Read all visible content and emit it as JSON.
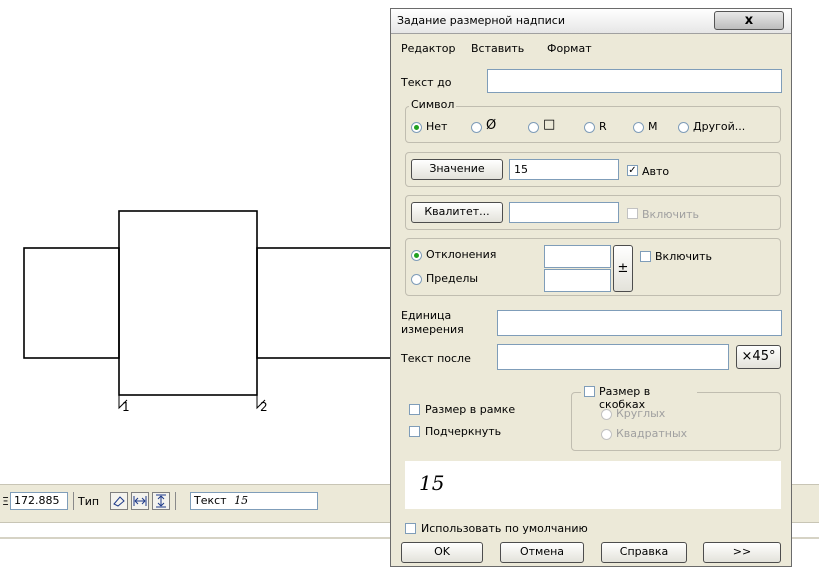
{
  "dialog": {
    "title": "Задание размерной надписи",
    "close_label": "x",
    "menu": [
      "Редактор",
      "Вставить",
      "Формат"
    ],
    "text_before_label": "Текст до",
    "text_before_value": "",
    "symbol_group_label": "Символ",
    "symbols": [
      "Нет",
      "Ø",
      "□",
      "R",
      "M",
      "Другой..."
    ],
    "value_button": "Значение",
    "value": "15",
    "auto_label": "Авто",
    "quality_button": "Квалитет...",
    "quality_value": "",
    "quality_include_label": "Включить",
    "deviations_label": "Отклонения",
    "limits_label": "Пределы",
    "plusminus_label": "±",
    "deviation_include_label": "Включить",
    "unit_label_1": "Единица",
    "unit_label_2": "измерения",
    "unit_value": "",
    "text_after_label": "Текст после",
    "text_after_value": "",
    "x45_button": "×45°",
    "size_in_frame_label": "Размер в рамке",
    "underline_label": "Подчеркнуть",
    "size_in_brackets_label": "Размер в скобках",
    "round_label": "Круглых",
    "square_label": "Квадратных",
    "preview_text": "15",
    "use_default_label": "Использовать по умолчанию",
    "ok_button": "OK",
    "cancel_button": "Отмена",
    "help_button": "Справка",
    "more_button": ">>"
  },
  "drawing": {
    "point1_label": "1",
    "point2_label": "2"
  },
  "panel": {
    "coord_prefix": "Ξ",
    "coord_value": "172.885",
    "type_label": "Тип",
    "text_label": "Текст",
    "text_value": "15"
  }
}
